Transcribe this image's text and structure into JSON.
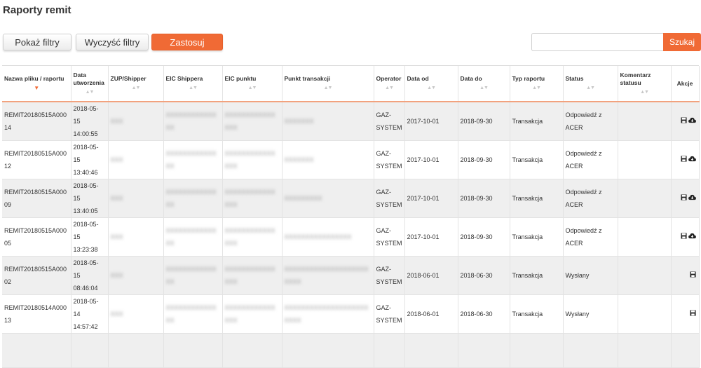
{
  "page": {
    "title": "Raporty remit"
  },
  "toolbar": {
    "show_filters": "Pokaż filtry",
    "clear_filters": "Wyczyść filtry",
    "apply": "Zastosuj",
    "search_button": "Szukaj",
    "search_value": ""
  },
  "colors": {
    "accent": "#f06a35",
    "row_shade": "#efefef"
  },
  "table": {
    "headers": [
      "Nazwa pliku / raportu",
      "Data utworzenia",
      "ZUP/Shipper",
      "EIC Shippera",
      "EIC punktu",
      "Punkt transakcji",
      "Operator",
      "Data od",
      "Data do",
      "Typ raportu",
      "Status",
      "Komentarz statusu",
      "Akcje"
    ],
    "rows": [
      {
        "name": "REMIT20180515A00014",
        "created": "2018-05-15 14:00:55",
        "zup": "XXX",
        "eic_shipper": "XXXXXXXXXXXXXX",
        "eic_point": "XXXXXXXXXXXXXXX",
        "point": "XXXXXXX",
        "operator": "GAZ-SYSTEM",
        "from": "2017-10-01",
        "to": "2018-09-30",
        "type": "Transakcja",
        "status": "Odpowiedź z ACER",
        "comment": "",
        "actions": [
          "save-icon",
          "cloud-download-icon"
        ]
      },
      {
        "name": "REMIT20180515A00012",
        "created": "2018-05-15 13:40:46",
        "zup": "XXX",
        "eic_shipper": "XXXXXXXXXXXXXX",
        "eic_point": "XXXXXXXXXXXXXXX",
        "point": "XXXXXXX",
        "operator": "GAZ-SYSTEM",
        "from": "2017-10-01",
        "to": "2018-09-30",
        "type": "Transakcja",
        "status": "Odpowiedź z ACER",
        "comment": "",
        "actions": [
          "save-icon",
          "cloud-download-icon"
        ]
      },
      {
        "name": "REMIT20180515A00009",
        "created": "2018-05-15 13:40:05",
        "zup": "XXX",
        "eic_shipper": "XXXXXXXXXXXXXX",
        "eic_point": "XXXXXXXXXXXXXXX",
        "point": "XXXXXXXXX",
        "operator": "GAZ-SYSTEM",
        "from": "2017-10-01",
        "to": "2018-09-30",
        "type": "Transakcja",
        "status": "Odpowiedź z ACER",
        "comment": "",
        "actions": [
          "save-icon",
          "cloud-download-icon"
        ]
      },
      {
        "name": "REMIT20180515A00005",
        "created": "2018-05-15 13:23:38",
        "zup": "XXX",
        "eic_shipper": "XXXXXXXXXXXXXX",
        "eic_point": "XXXXXXXXXXXXXXX",
        "point": "XXXXXXXXXXXXXXXX",
        "operator": "GAZ-SYSTEM",
        "from": "2017-10-01",
        "to": "2018-09-30",
        "type": "Transakcja",
        "status": "Odpowiedź z ACER",
        "comment": "",
        "actions": [
          "save-icon",
          "cloud-download-icon"
        ]
      },
      {
        "name": "REMIT20180515A00002",
        "created": "2018-05-15 08:46:04",
        "zup": "XXX",
        "eic_shipper": "XXXXXXXXXXXXXX",
        "eic_point": "XXXXXXXXXXXXXXX",
        "point": "XXXXXXXXXXXXXXXXXXXXXXXX",
        "operator": "GAZ-SYSTEM",
        "from": "2018-06-01",
        "to": "2018-06-30",
        "type": "Transakcja",
        "status": "Wysłany",
        "comment": "",
        "actions": [
          "save-icon"
        ]
      },
      {
        "name": "REMIT20180514A00013",
        "created": "2018-05-14 14:57:42",
        "zup": "XXX",
        "eic_shipper": "XXXXXXXXXXXXXX",
        "eic_point": "XXXXXXXXXXXXXXX",
        "point": "XXXXXXXXXXXXXXXXXXXXXXXX",
        "operator": "GAZ-SYSTEM",
        "from": "2018-06-01",
        "to": "2018-06-30",
        "type": "Transakcja",
        "status": "Wysłany",
        "comment": "",
        "actions": [
          "save-icon"
        ]
      },
      {
        "name": "",
        "created": "",
        "zup": "",
        "eic_shipper": "",
        "eic_point": "",
        "point": "",
        "operator": "",
        "from": "",
        "to": "",
        "type": "",
        "status": "",
        "comment": "",
        "actions": []
      }
    ]
  }
}
